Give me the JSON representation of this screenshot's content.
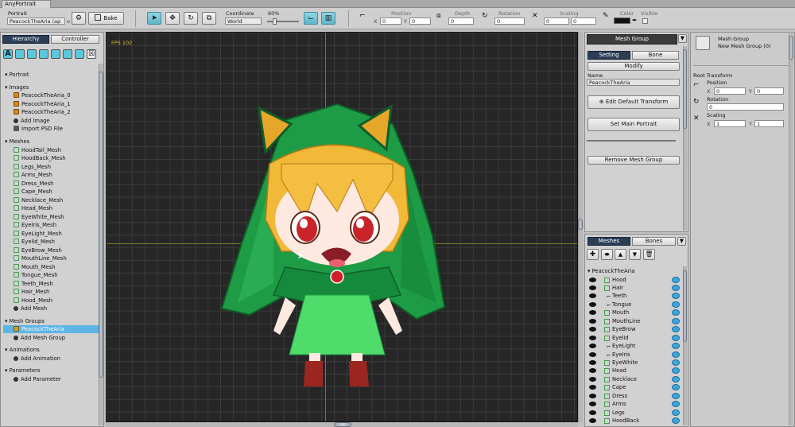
{
  "window": {
    "tab_title": "AnyPortrait"
  },
  "toolbar": {
    "portrait_label": "Portrait",
    "portrait_value": "PeacockTheAria (ap",
    "portrait_suffix": "o",
    "bake_label": "Bake",
    "coordinate_label": "Coordinate",
    "coordinate_value": "World",
    "zoom_value": "60%",
    "position_label": "Position",
    "position_x_label": "X",
    "position_x": "0",
    "position_y_label": "Y",
    "position_y": "0",
    "depth_label": "Depth",
    "depth_value": "0",
    "rotation_label": "Rotation",
    "rotation_value": "0",
    "scaling_label": "Scaling",
    "scaling_x": "0",
    "scaling_y": "0",
    "color_label": "Color",
    "visible_label": "Visible"
  },
  "hierarchy": {
    "tab_hierarchy": "Hierarchy",
    "tab_controller": "Controller",
    "filter_buttons": [
      "A",
      "",
      "",
      "",
      "",
      "",
      "",
      ""
    ],
    "sections": {
      "portrait": "Portrait",
      "images": "Images",
      "meshes": "Meshes",
      "mesh_groups": "Mesh Groups",
      "animations": "Animations",
      "parameters": "Parameters"
    },
    "images": [
      "PeacockTheAria_0",
      "PeacockTheAria_1",
      "PeacockTheAria_2"
    ],
    "add_image": "Add Image",
    "import_psd": "Import PSD File",
    "meshes": [
      "HoodTail_Mesh",
      "HoodBack_Mesh",
      "Legs_Mesh",
      "Arms_Mesh",
      "Dress_Mesh",
      "Cape_Mesh",
      "Necklace_Mesh",
      "Head_Mesh",
      "EyeWhite_Mesh",
      "EyeIris_Mesh",
      "EyeLight_Mesh",
      "Eyelid_Mesh",
      "EyeBrow_Mesh",
      "MouthLine_Mesh",
      "Mouth_Mesh",
      "Tongue_Mesh",
      "Teeth_Mesh",
      "Hair_Mesh",
      "Hood_Mesh"
    ],
    "add_mesh": "Add Mesh",
    "mesh_groups": [
      "PeacockTheAria"
    ],
    "add_mesh_group": "Add Mesh Group",
    "add_animation": "Add Animation",
    "add_parameter": "Add Parameter"
  },
  "viewport": {
    "fps": "FPS 102"
  },
  "mesh_group_panel": {
    "header": "Mesh Group",
    "tab_setting": "Setting",
    "tab_bone": "Bone",
    "modify_label": "Modify",
    "name_label": "Name",
    "name_value": "PeacockTheAria",
    "edit_default_transform": "Edit Default Transform",
    "set_main_portrait": "Set Main Portrait",
    "remove_mesh_group": "Remove Mesh Group"
  },
  "meshes_panel": {
    "tab_meshes": "Meshes",
    "tab_bones": "Bones",
    "root": "PeacockTheAria",
    "items": [
      {
        "name": "Hood",
        "type": "mesh"
      },
      {
        "name": "Hair",
        "type": "mesh"
      },
      {
        "name": "Teeth",
        "type": "clip"
      },
      {
        "name": "Tongue",
        "type": "clip"
      },
      {
        "name": "Mouth",
        "type": "mesh"
      },
      {
        "name": "MouthLine",
        "type": "mesh"
      },
      {
        "name": "EyeBrow",
        "type": "mesh"
      },
      {
        "name": "Eyelid",
        "type": "mesh"
      },
      {
        "name": "EyeLight",
        "type": "clip"
      },
      {
        "name": "EyeIris",
        "type": "clip"
      },
      {
        "name": "EyeWhite",
        "type": "mesh"
      },
      {
        "name": "Head",
        "type": "mesh"
      },
      {
        "name": "Necklace",
        "type": "mesh"
      },
      {
        "name": "Cape",
        "type": "mesh"
      },
      {
        "name": "Dress",
        "type": "mesh"
      },
      {
        "name": "Arms",
        "type": "mesh"
      },
      {
        "name": "Legs",
        "type": "mesh"
      },
      {
        "name": "HoodBack",
        "type": "mesh"
      }
    ]
  },
  "inspector": {
    "type_label": "Mesh Group",
    "name_label": "New Mesh Group (0)",
    "root_transform": "Root Transform",
    "position_label": "Position",
    "pos_x_label": "X",
    "pos_x": "0",
    "pos_y_label": "Y",
    "pos_y": "0",
    "rotation_label": "Rotation",
    "rotation": "0",
    "scaling_label": "Scaling",
    "scale_x_label": "X",
    "scale_x": "1",
    "scale_y_label": "Y",
    "scale_y": "1"
  },
  "colors": {
    "selection": "#5db5e6",
    "active_tab": "#2b3d57",
    "tool_on": "#5fb5c8",
    "viewport_bg": "#262626",
    "hood_green": "#1e9c45"
  }
}
